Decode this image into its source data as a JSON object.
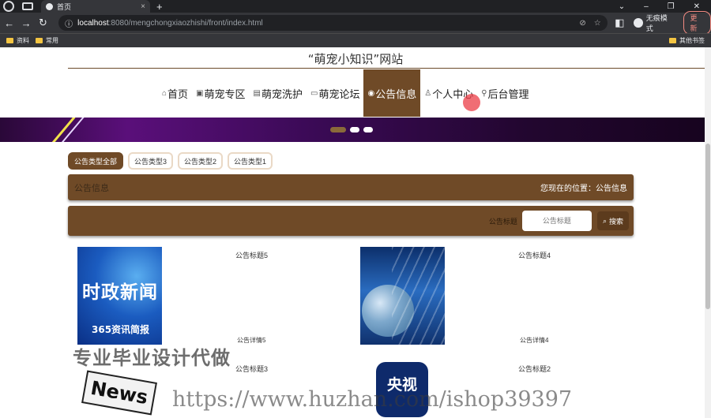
{
  "browser": {
    "tab_title": "首页",
    "url_host": "localhost",
    "url_path": ":8080/mengchongxiaozhishi/front/index.html",
    "profile": "无痕模式",
    "update": "更新",
    "bookmarks": [
      "资料",
      "常用"
    ],
    "other_bookmarks": "其他书签"
  },
  "site": {
    "title": "“萌宠小知识”网站"
  },
  "menu": [
    {
      "label": "首页",
      "icon": "home-icon",
      "glyph": "⌂"
    },
    {
      "label": "萌宠专区",
      "icon": "grid-icon",
      "glyph": "▣"
    },
    {
      "label": "萌宠洗护",
      "icon": "list-icon",
      "glyph": "▤"
    },
    {
      "label": "萌宠论坛",
      "icon": "forum-icon",
      "glyph": "▭"
    },
    {
      "label": "公告信息",
      "icon": "notice-icon",
      "glyph": "◉",
      "active": true
    },
    {
      "label": "个人中心",
      "icon": "user-icon",
      "glyph": "♙"
    },
    {
      "label": "后台管理",
      "icon": "link-icon",
      "glyph": "⚲"
    }
  ],
  "types": [
    "公告类型全部",
    "公告类型3",
    "公告类型2",
    "公告类型1"
  ],
  "breadcrumb": {
    "title": "公告信息",
    "position": "您现在的位置：公告信息"
  },
  "search": {
    "label": "公告标题",
    "placeholder": "公告标题",
    "button": "搜索"
  },
  "cards": [
    {
      "title": "公告标题5",
      "detail": "公告详情5",
      "img_big": "时政新闻",
      "img_small": "365资讯简报"
    },
    {
      "title": "公告标题4",
      "detail": "公告详情4"
    },
    {
      "title": "公告标题3",
      "img_text": "News"
    },
    {
      "title": "公告标题2",
      "img_text": "央视"
    }
  ],
  "watermarks": [
    "专业毕业设计代做",
    "https://www.huzhan.com/ishop39397"
  ],
  "colors": {
    "accent": "#6f4a27",
    "chrome": "#202124"
  }
}
